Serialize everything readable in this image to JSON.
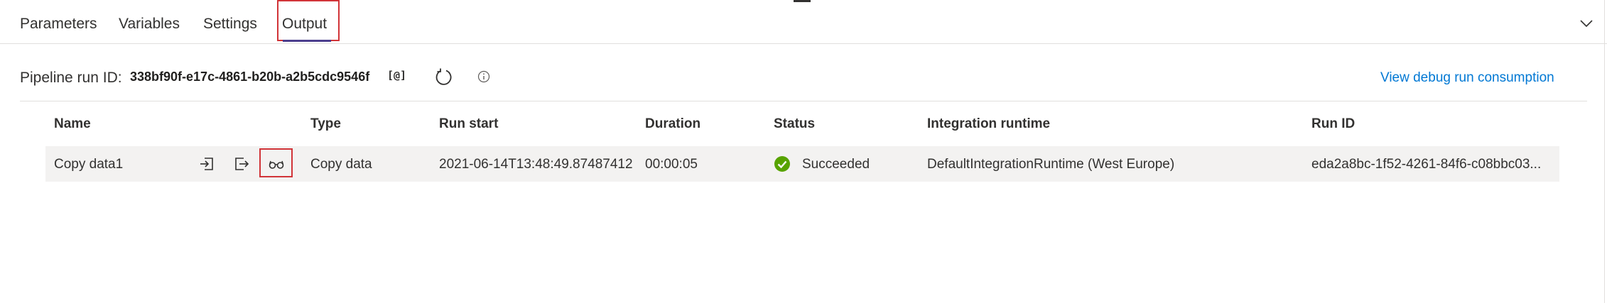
{
  "tabs": {
    "parameters": "Parameters",
    "variables": "Variables",
    "settings": "Settings",
    "output": "Output"
  },
  "pipeline": {
    "run_id_label": "Pipeline run ID:",
    "run_id_value": "338bf90f-e17c-4861-b20b-a2b5cdc9546f",
    "copy_icon": "[@]",
    "consumption_link": "View debug run consumption"
  },
  "table": {
    "headers": {
      "name": "Name",
      "type": "Type",
      "run_start": "Run start",
      "duration": "Duration",
      "status": "Status",
      "integration_runtime": "Integration runtime",
      "run_id": "Run ID"
    },
    "rows": [
      {
        "name": "Copy data1",
        "type": "Copy data",
        "run_start": "2021-06-14T13:48:49.87487412",
        "duration": "00:00:05",
        "status": "Succeeded",
        "integration_runtime": "DefaultIntegrationRuntime (West Europe)",
        "run_id": "eda2a8bc-1f52-4261-84f6-c08bbc03..."
      }
    ]
  },
  "colors": {
    "accent": "#4b3f8e",
    "link": "#0078d4",
    "highlight": "#d13438",
    "success": "#57a300"
  }
}
